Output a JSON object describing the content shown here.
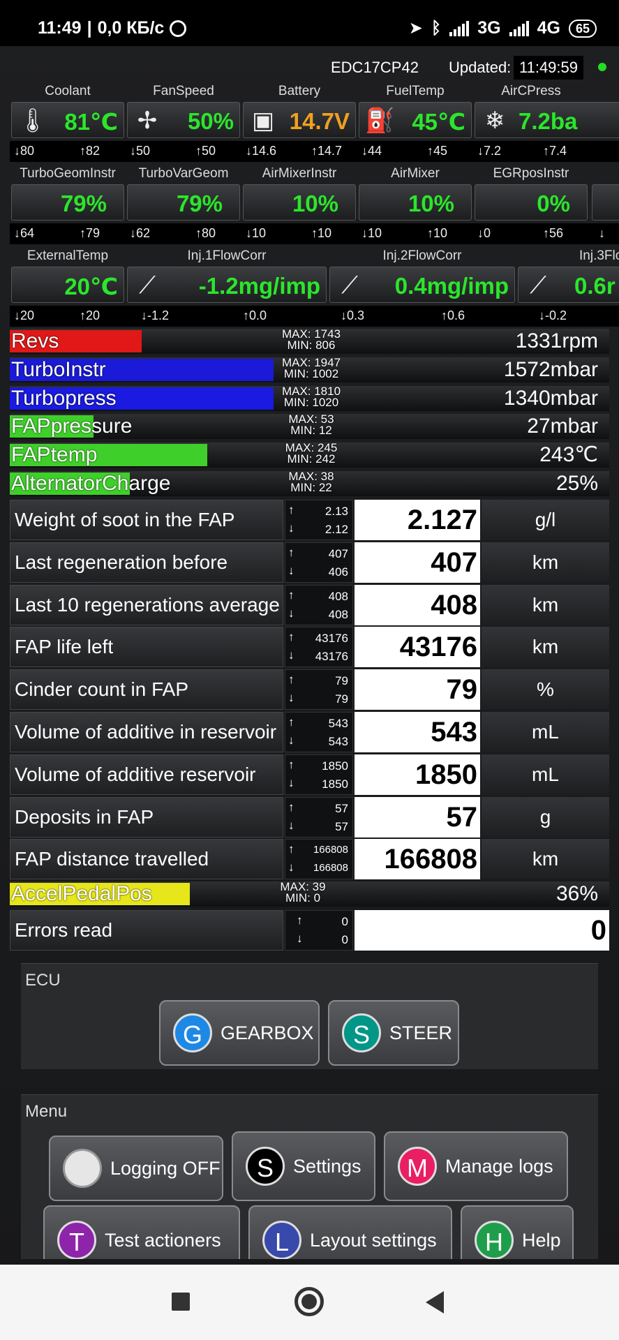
{
  "status": {
    "time": "11:49",
    "sep": "|",
    "speed": "0,0 КБ/с",
    "net1": "3G",
    "net2": "4G",
    "battery": "65"
  },
  "header": {
    "ecu": "EDC17CP42",
    "updated_label": "Updated:",
    "updated_time": "11:49:59"
  },
  "gauges_row1": [
    {
      "name": "Coolant",
      "value": "81℃",
      "min": "80",
      "max": "82",
      "icon": "thermometer-icon"
    },
    {
      "name": "FanSpeed",
      "value": "50%",
      "min": "50",
      "max": "50",
      "icon": "fan-icon"
    },
    {
      "name": "Battery",
      "value": "14.7V",
      "min": "14.6",
      "max": "14.7",
      "icon": "battery-icon",
      "color": "#f0a020"
    },
    {
      "name": "FuelTemp",
      "value": "45℃",
      "min": "44",
      "max": "45",
      "icon": "fuel-pump-icon"
    },
    {
      "name": "AirCPress",
      "value": "7.2ba",
      "min": "7.2",
      "max": "7.4",
      "icon": "snowflake-icon"
    }
  ],
  "gauges_row2": [
    {
      "name": "TurboGeomInstr",
      "value": "79%",
      "min": "64",
      "max": "79"
    },
    {
      "name": "TurboVarGeom",
      "value": "79%",
      "min": "62",
      "max": "80"
    },
    {
      "name": "AirMixerInstr",
      "value": "10%",
      "min": "10",
      "max": "10"
    },
    {
      "name": "AirMixer",
      "value": "10%",
      "min": "10",
      "max": "10"
    },
    {
      "name": "EGRposInstr",
      "value": "0%",
      "min": "0",
      "max": "56"
    }
  ],
  "gauges_row3": [
    {
      "name": "ExternalTemp",
      "value": "20℃",
      "min": "20",
      "max": "20"
    },
    {
      "name": "Inj.1FlowCorr",
      "value": "-1.2mg/imp",
      "min": "-1.2",
      "max": "0.0",
      "icon": "injector-icon"
    },
    {
      "name": "Inj.2FlowCorr",
      "value": "0.4mg/imp",
      "min": "0.3",
      "max": "0.6",
      "icon": "injector-icon"
    },
    {
      "name": "Inj.3Flo",
      "value": "0.6r",
      "min": "-0.2",
      "max": "",
      "icon": "injector-icon"
    }
  ],
  "bars": [
    {
      "name": "Revs",
      "max": "MAX: 1743",
      "min": "MIN: 806",
      "value": "1331rpm",
      "fill": 0.22,
      "color": "#e01818"
    },
    {
      "name": "TurboInstr",
      "max": "MAX: 1947",
      "min": "MIN: 1002",
      "value": "1572mbar",
      "fill": 0.44,
      "color": "#1a1ad8"
    },
    {
      "name": "Turbopress",
      "max": "MAX: 1810",
      "min": "MIN: 1020",
      "value": "1340mbar",
      "fill": 0.44,
      "color": "#1a1ae0"
    },
    {
      "name": "FAPpressure",
      "max": "MAX: 53",
      "min": "MIN: 12",
      "value": "27mbar",
      "fill": 0.14,
      "color": "#3fcf2a"
    },
    {
      "name": "FAPtemp",
      "max": "MAX: 245",
      "min": "MIN: 242",
      "value": "243℃",
      "fill": 0.33,
      "color": "#3fcf2a"
    },
    {
      "name": "AlternatorCharge",
      "max": "MAX: 38",
      "min": "MIN: 22",
      "value": "25%",
      "fill": 0.2,
      "color": "#3fcf2a"
    }
  ],
  "table": [
    {
      "label": "Weight of soot in the FAP",
      "max": "2.13",
      "min": "2.12",
      "value": "2.127",
      "unit": "g/l"
    },
    {
      "label": "Last regeneration before",
      "max": "407",
      "min": "406",
      "value": "407",
      "unit": "km"
    },
    {
      "label": "Last 10 regenerations average",
      "max": "408",
      "min": "408",
      "value": "408",
      "unit": "km"
    },
    {
      "label": "FAP life left",
      "max": "43176",
      "min": "43176",
      "value": "43176",
      "unit": "km"
    },
    {
      "label": "Cinder count in FAP",
      "max": "79",
      "min": "79",
      "value": "79",
      "unit": "%"
    },
    {
      "label": "Volume of additive in reservoir",
      "max": "543",
      "min": "543",
      "value": "543",
      "unit": "mL"
    },
    {
      "label": "Volume of additive reservoir",
      "max": "1850",
      "min": "1850",
      "value": "1850",
      "unit": "mL"
    },
    {
      "label": "Deposits in FAP",
      "max": "57",
      "min": "57",
      "value": "57",
      "unit": "g"
    },
    {
      "label": "FAP distance travelled",
      "max": "166808",
      "min": "166808",
      "value": "166808",
      "unit": "km"
    }
  ],
  "accel_bar": {
    "name": "AccelPedalPos",
    "max": "MAX: 39",
    "min": "MIN: 0",
    "value": "36%",
    "fill": 0.3,
    "color": "#e6e61a"
  },
  "errors_row": {
    "label": "Errors read",
    "max": "0",
    "min": "0",
    "value": "0"
  },
  "ecu_panel": {
    "title": "ECU",
    "gearbox": {
      "letter": "G",
      "label": "GEARBOX"
    },
    "steer": {
      "letter": "S",
      "label": "STEER"
    }
  },
  "menu_panel": {
    "title": "Menu",
    "logging": {
      "label": "Logging OFF"
    },
    "settings": {
      "letter": "S",
      "label": "Settings"
    },
    "manage_logs": {
      "letter": "M",
      "label": "Manage logs"
    },
    "test_actioners": {
      "letter": "T",
      "label": "Test actioners"
    },
    "layout_settings": {
      "letter": "L",
      "label": "Layout settings"
    },
    "help": {
      "letter": "H",
      "label": "Help"
    }
  },
  "arrows": {
    "up": "↑",
    "down": "↓"
  }
}
